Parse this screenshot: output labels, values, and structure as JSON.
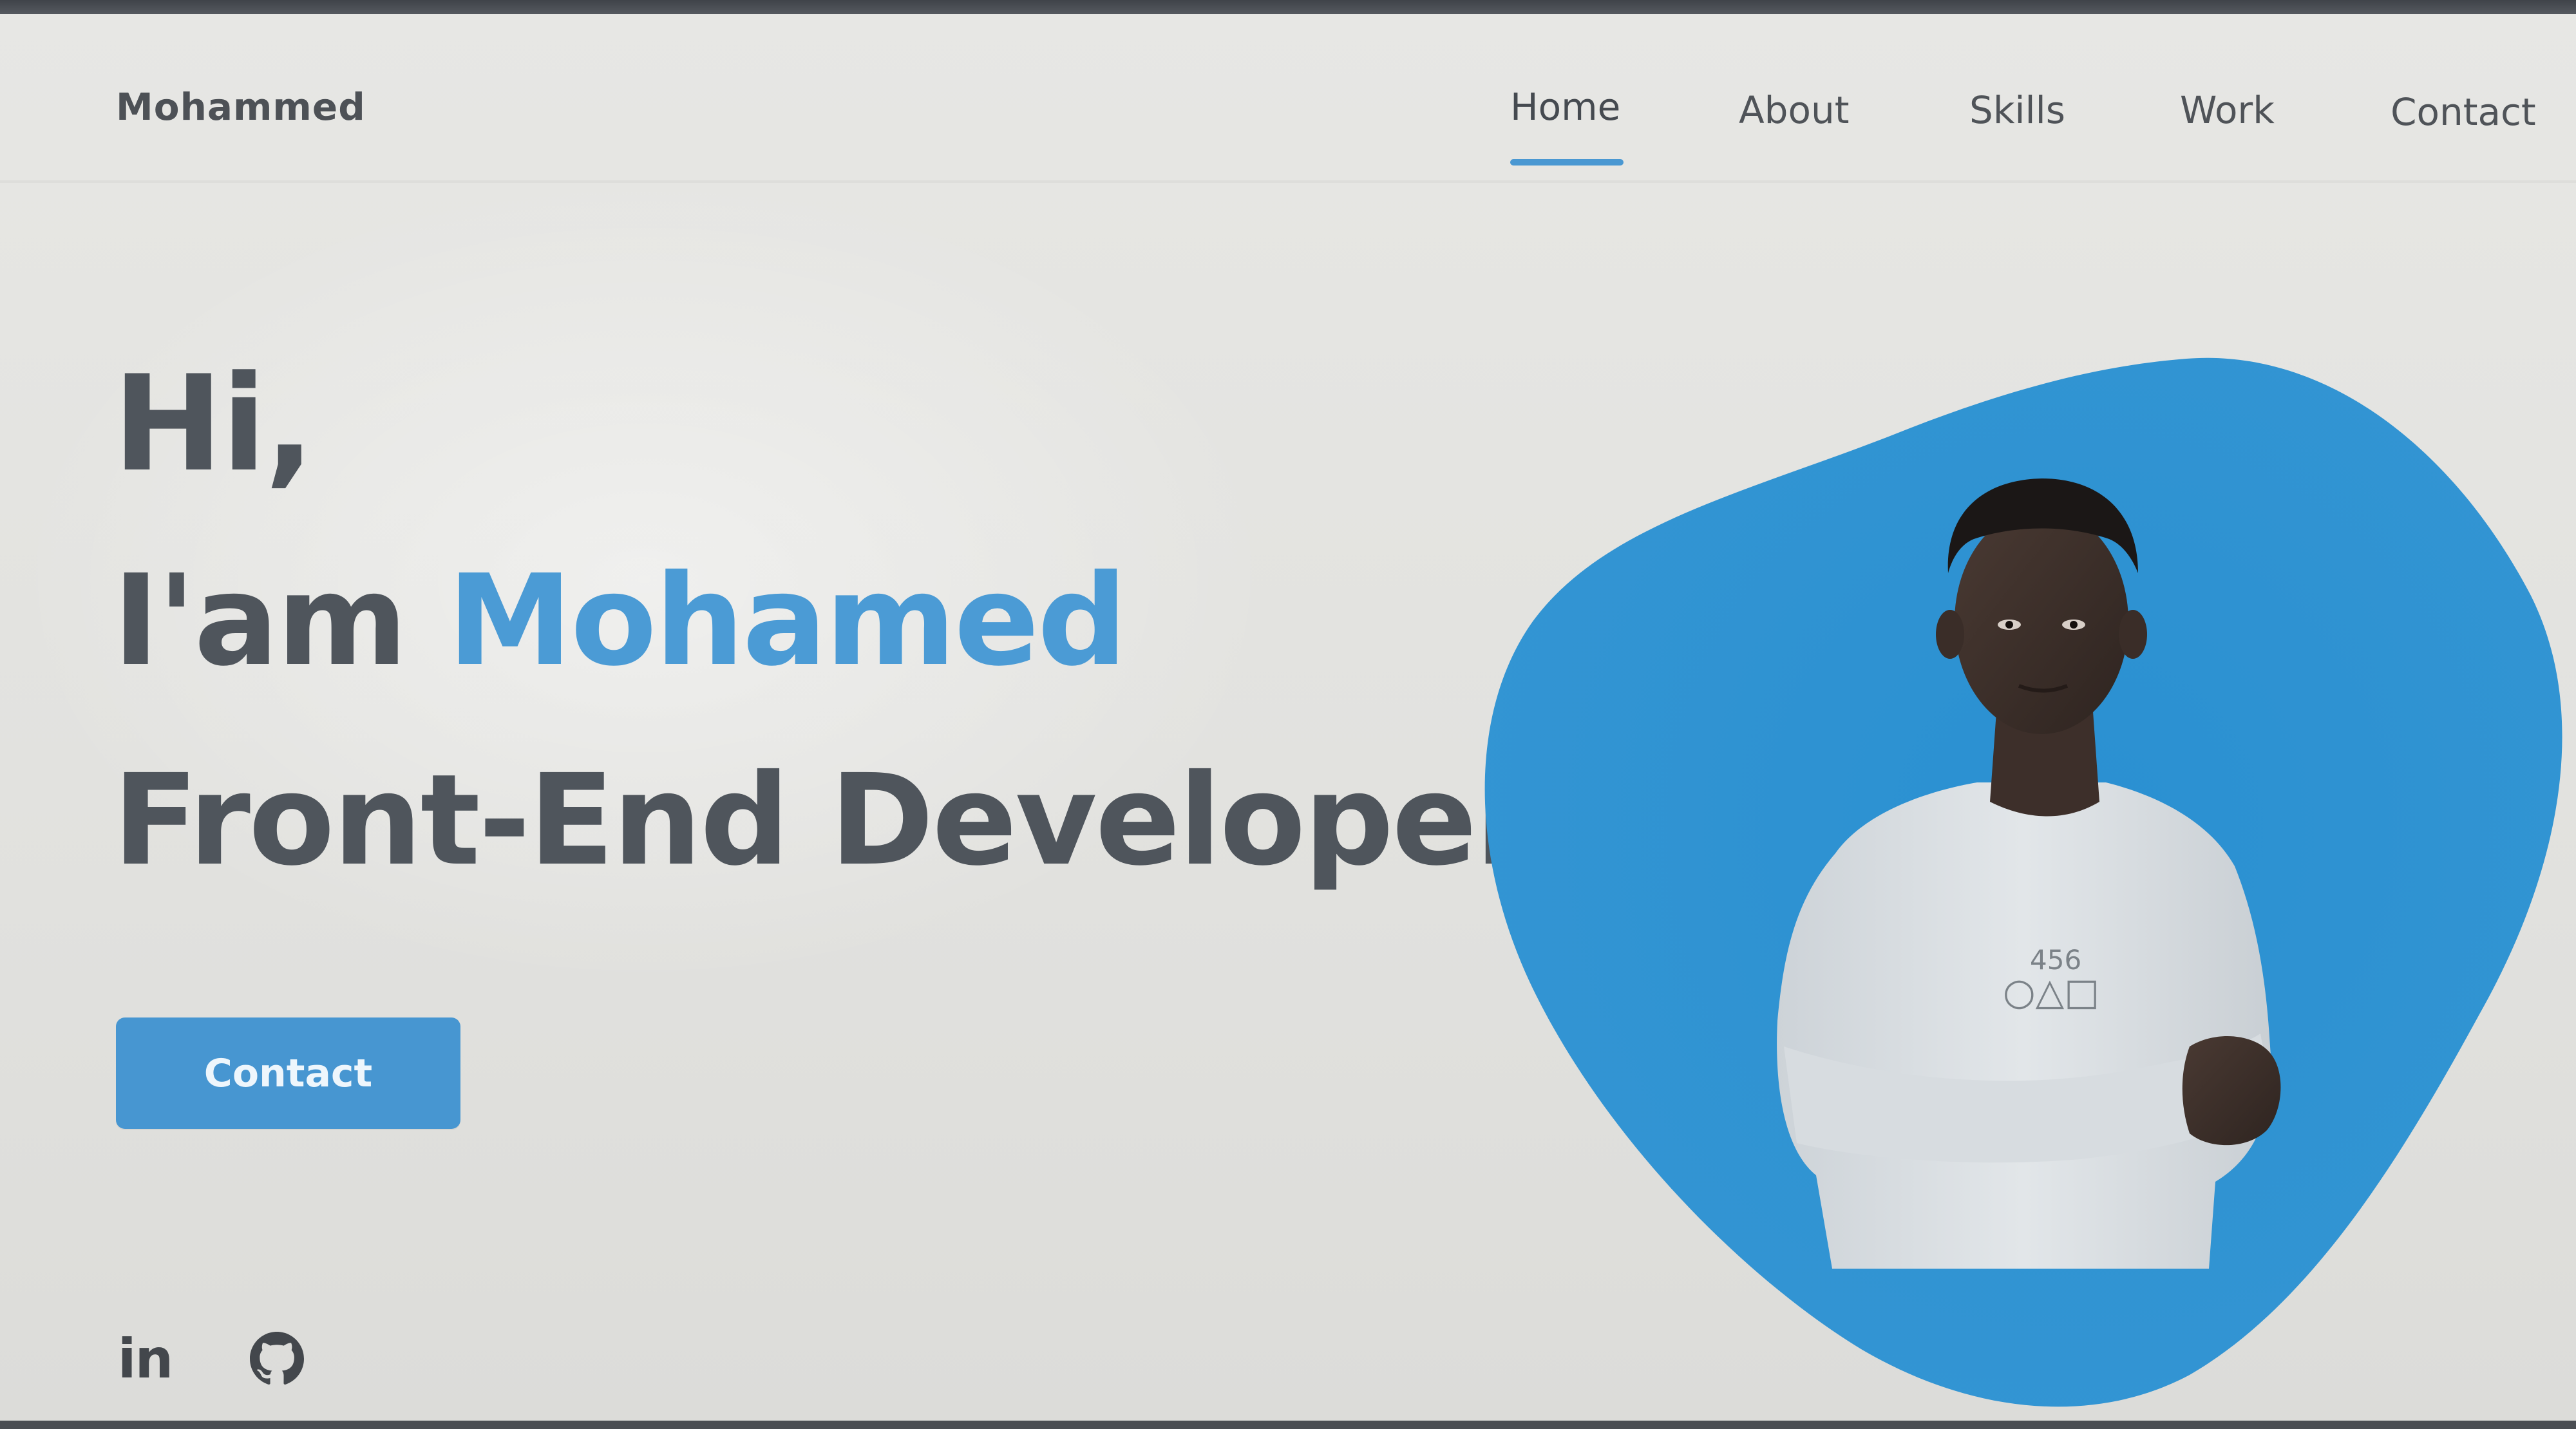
{
  "header": {
    "logo": "Mohammed",
    "nav": [
      {
        "label": "Home",
        "active": true
      },
      {
        "label": "About",
        "active": false
      },
      {
        "label": "Skills",
        "active": false
      },
      {
        "label": "Work",
        "active": false
      },
      {
        "label": "Contact",
        "active": false
      }
    ]
  },
  "hero": {
    "greeting": "Hi,",
    "intro": "I'am",
    "name": "Mohamed",
    "role": "Front-End Developer",
    "contact_label": "Contact",
    "shirt_print": "456",
    "shirt_shapes": "○△□"
  },
  "social": {
    "linkedin_label": "in"
  },
  "colors": {
    "accent": "#4b9bd5",
    "button": "#4796d1",
    "blob": "#2b8fd0",
    "text": "#4f555c",
    "background": "#e4e4e1"
  },
  "icons": {
    "linkedin": "linkedin-icon",
    "github": "github-icon"
  }
}
